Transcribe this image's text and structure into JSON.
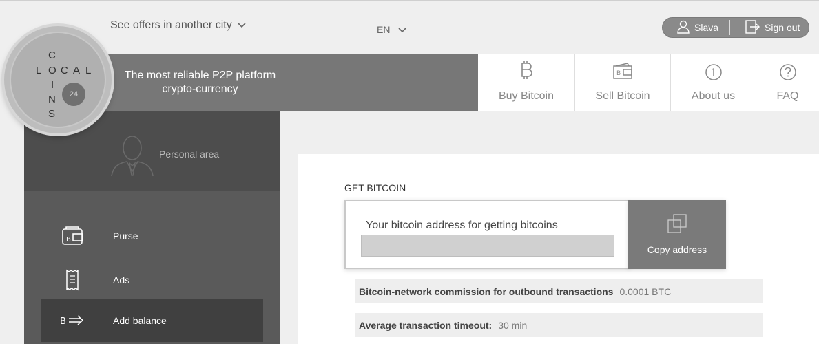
{
  "header": {
    "city_link": "See offers in another city",
    "language": "EN",
    "user_name": "Slava",
    "sign_out": "Sign out",
    "tagline": "The most reliable P2P platform crypto-currency"
  },
  "logo": {
    "letters": [
      "C",
      "L",
      "O",
      "C",
      "A",
      "L",
      "I",
      "N",
      "S"
    ],
    "badge": "24"
  },
  "nav": {
    "items": [
      {
        "label": "Buy Bitcoin",
        "icon": "bitcoin-icon"
      },
      {
        "label": "Sell Bitcoin",
        "icon": "wallet-bitcoin-icon"
      },
      {
        "label": "About us",
        "icon": "info-circle-icon"
      },
      {
        "label": "FAQ",
        "icon": "question-circle-icon"
      }
    ]
  },
  "sidebar": {
    "personal_area": "Personal area",
    "items": [
      {
        "label": "Purse",
        "icon": "purse-icon"
      },
      {
        "label": "Ads",
        "icon": "receipt-icon"
      },
      {
        "label": "Add balance",
        "icon": "bitcoin-arrow-icon",
        "active": true
      }
    ]
  },
  "main": {
    "title": "GET BITCOIN",
    "address_label": "Your bitcoin address for getting bitcoins",
    "address_value": "",
    "copy_label": "Copy address",
    "info": [
      {
        "key": "Bitcoin-network commission for outbound transactions",
        "value": "0.0001 BTC"
      },
      {
        "key": "Average transaction timeout:",
        "value": "30 min"
      }
    ]
  },
  "colors": {
    "hero_band": "#777777",
    "sidebar": "#5a5a5a",
    "sidebar_active": "#404040",
    "copy_button": "#7a7a7a",
    "user_pill": "#8a8a8a"
  }
}
